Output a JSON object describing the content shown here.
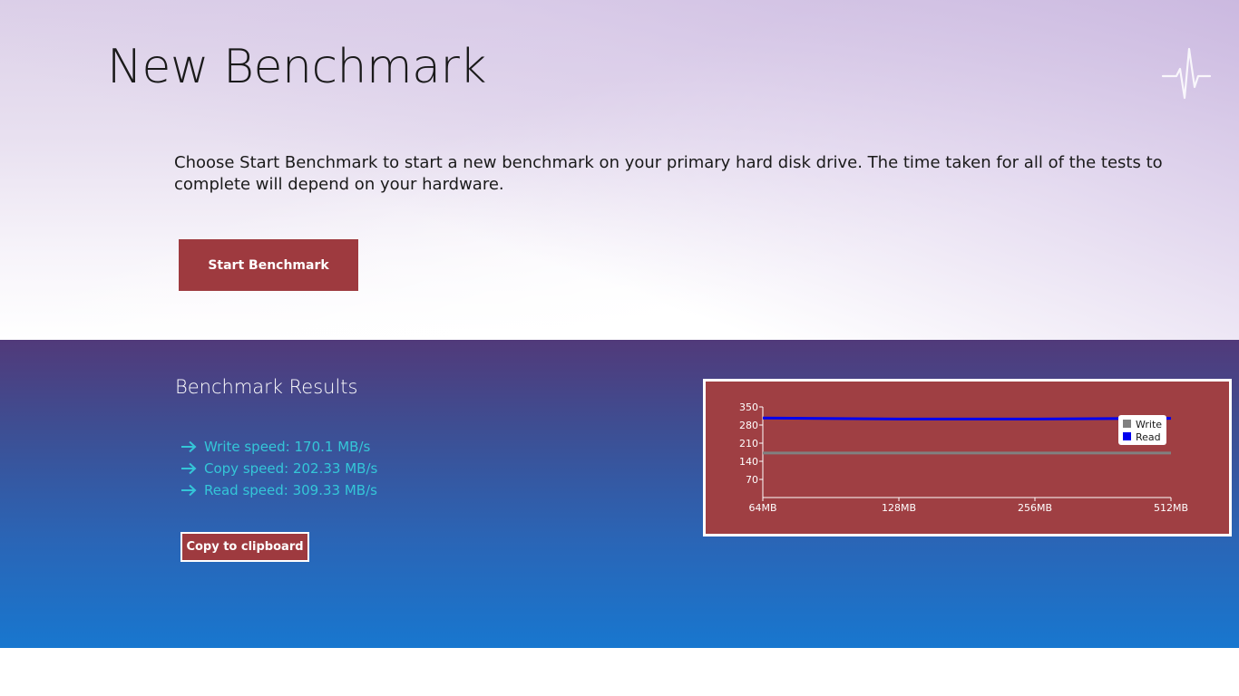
{
  "header": {
    "title": "New Benchmark",
    "logo_icon": "pulse-icon"
  },
  "intro": {
    "description": "Choose Start Benchmark to start a new benchmark on your primary hard disk drive.  The time taken for all of the tests to complete will depend on your hardware.",
    "start_label": "Start Benchmark"
  },
  "results": {
    "title": "Benchmark Results",
    "items": [
      {
        "icon": "arrow-right-icon",
        "text": "Write speed: 170.1 MB/s"
      },
      {
        "icon": "arrow-right-icon",
        "text": "Copy speed: 202.33 MB/s"
      },
      {
        "icon": "arrow-right-icon",
        "text": "Read speed: 309.33 MB/s"
      }
    ],
    "copy_label": "Copy to clipboard"
  },
  "colors": {
    "accent": "#9e3a3f",
    "result_text": "#34c6d8",
    "write_series": "#808080",
    "read_series": "#0000ee"
  },
  "chart_data": {
    "type": "line",
    "x": [
      "64MB",
      "128MB",
      "256MB",
      "512MB"
    ],
    "ylim": [
      0,
      350
    ],
    "yticks": [
      70,
      140,
      210,
      280,
      350
    ],
    "series": [
      {
        "name": "Write",
        "color": "#808080",
        "values": [
          172,
          172,
          172,
          172
        ]
      },
      {
        "name": "Read",
        "color": "#0000ee",
        "values": [
          307,
          303,
          303,
          306
        ]
      }
    ],
    "legend": "top-right",
    "grid": false
  }
}
